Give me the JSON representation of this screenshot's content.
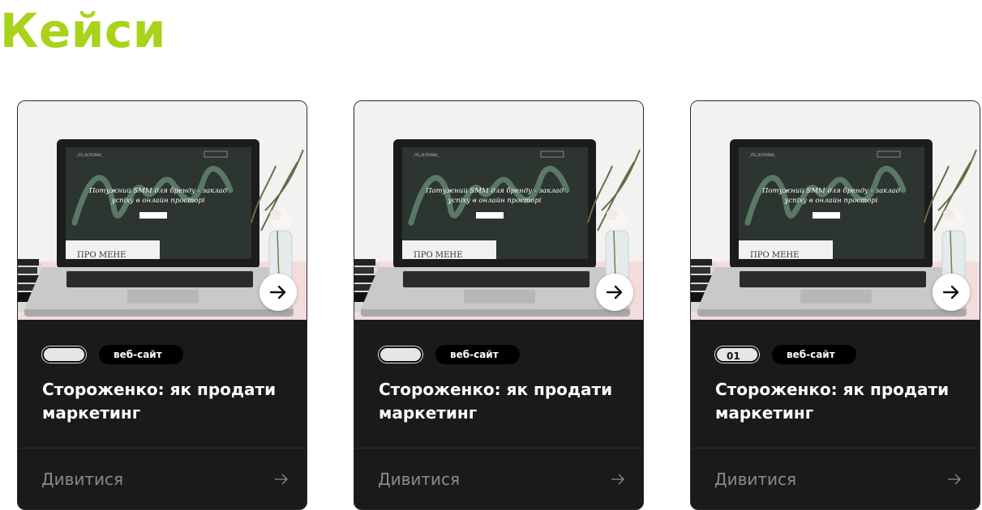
{
  "page": {
    "title": "Кейси"
  },
  "cards": [
    {
      "tag_number": "",
      "tag_category": "веб-сайт",
      "title": "Стороженко: як продати маркетинг",
      "link_label": "Дивитися",
      "image": {
        "brand": "_ITS_OLTYOSKA_",
        "headline_1": "Потужний SMM для бренду - заклад",
        "headline_2": "успіху в онлайн просторі",
        "section": "ПРО МЕНЕ"
      }
    },
    {
      "tag_number": "",
      "tag_category": "веб-сайт",
      "title": "Стороженко: як продати маркетинг",
      "link_label": "Дивитися",
      "image": {
        "brand": "_ITS_OLTYOSKA_",
        "headline_1": "Потужний SMM для бренду - заклад",
        "headline_2": "успіху в онлайн просторі",
        "section": "ПРО МЕНЕ"
      }
    },
    {
      "tag_number": "01",
      "tag_category": "веб-сайт",
      "title": "Стороженко: як продати маркетинг",
      "link_label": "Дивитися",
      "image": {
        "brand": "_ITS_OLTYOSKA_",
        "headline_1": "Потужний SMM для бренду - заклад",
        "headline_2": "успіху в онлайн просторі",
        "section": "ПРО МЕНЕ"
      }
    }
  ],
  "colors": {
    "accent": "#a8d31a",
    "card_bg": "#1a1a1a",
    "muted_text": "#8a8a8a"
  },
  "icons": {
    "card_arrow": "arrow-right-icon",
    "link_arrow": "arrow-right-thin-icon"
  }
}
